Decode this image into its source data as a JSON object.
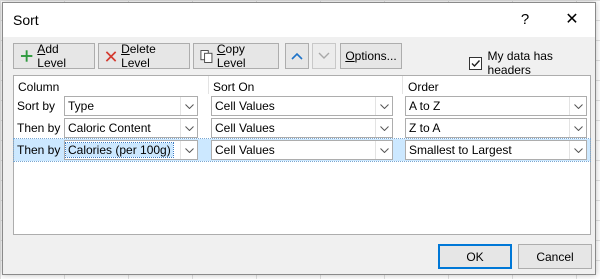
{
  "dialog": {
    "title": "Sort",
    "help_label": "?",
    "close_label": "✕"
  },
  "toolbar": {
    "add_level": {
      "mnemonic": "A",
      "rest": "dd Level"
    },
    "delete_level": {
      "mnemonic": "D",
      "rest": "elete Level"
    },
    "copy_level": {
      "mnemonic": "C",
      "rest": "opy Level"
    },
    "options": {
      "mnemonic": "O",
      "rest": "ptions..."
    },
    "headers_checkbox_label": "My data has headers",
    "headers_checked": true
  },
  "grid": {
    "headers": {
      "column": "Column",
      "sort_on": "Sort On",
      "order": "Order"
    },
    "rows": [
      {
        "label": "Sort by",
        "column": "Type",
        "sort_on": "Cell Values",
        "order": "A to Z",
        "selected": false
      },
      {
        "label": "Then by",
        "column": "Caloric Content",
        "sort_on": "Cell Values",
        "order": "Z to A",
        "selected": false
      },
      {
        "label": "Then by",
        "column": "Calories (per 100g)",
        "sort_on": "Cell Values",
        "order": "Smallest to Largest",
        "selected": true
      }
    ]
  },
  "buttons": {
    "ok": "OK",
    "cancel": "Cancel"
  },
  "colors": {
    "selection": "#cce8ff",
    "accent": "#0078d7",
    "up_arrow": "#1e73c8"
  },
  "icons": {
    "add": "green-plus-icon",
    "delete": "red-x-icon",
    "copy": "copy-icon",
    "move_up": "chevron-up-icon",
    "move_down": "chevron-down-icon",
    "dropdown": "dropdown-arrow-icon"
  }
}
